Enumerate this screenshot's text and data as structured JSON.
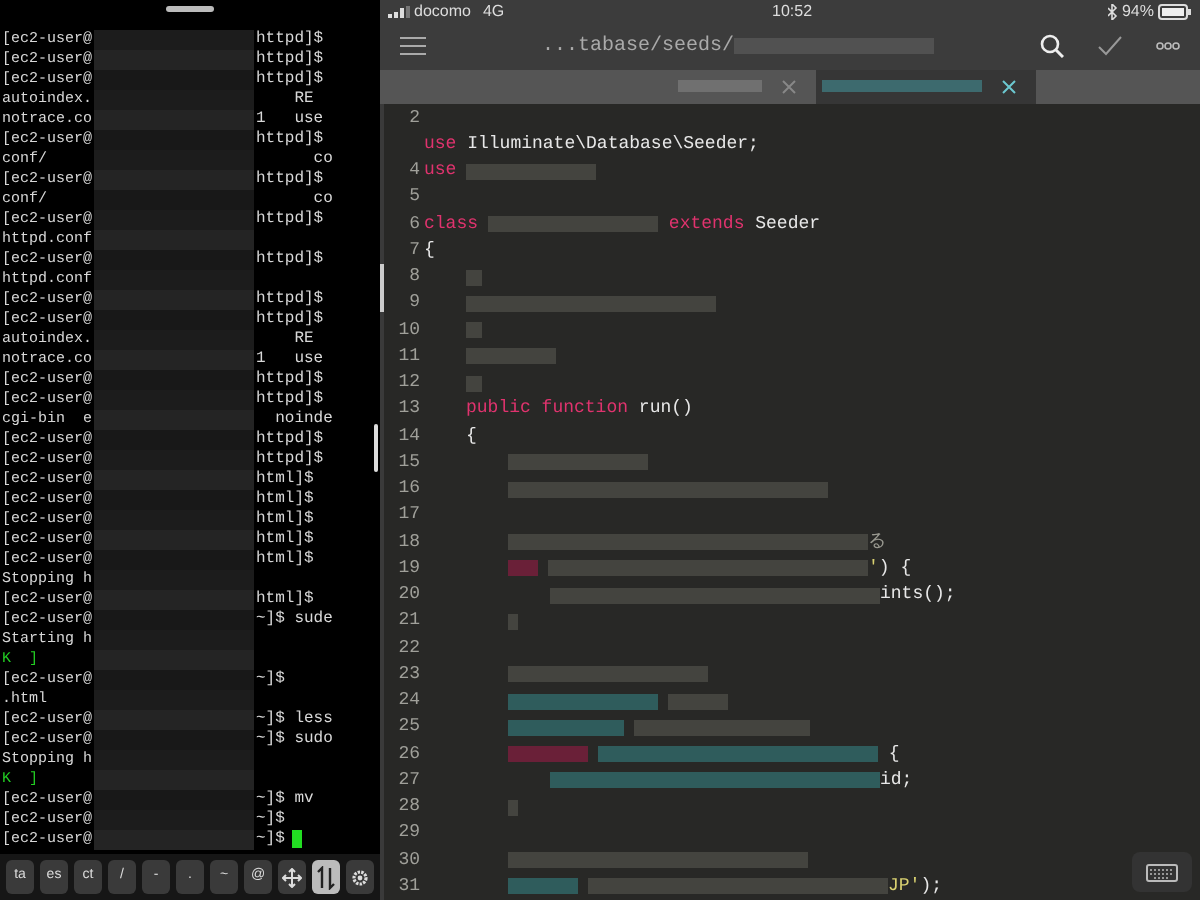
{
  "terminal": {
    "lines": [
      {
        "left": "[ec2-user@",
        "right": "httpd]$"
      },
      {
        "left": "[ec2-user@",
        "right": "httpd]$"
      },
      {
        "left": "[ec2-user@",
        "right": "httpd]$"
      },
      {
        "left": "autoindex.",
        "right": "    RE"
      },
      {
        "left": "notrace.co",
        "right": "1   use"
      },
      {
        "left": "[ec2-user@",
        "right": "httpd]$"
      },
      {
        "left": "conf/",
        "right": "      co"
      },
      {
        "left": "[ec2-user@",
        "right": "httpd]$"
      },
      {
        "left": "conf/",
        "right": "      co"
      },
      {
        "left": "[ec2-user@",
        "right": "httpd]$"
      },
      {
        "left": "httpd.conf"
      },
      {
        "left": "[ec2-user@",
        "right": "httpd]$"
      },
      {
        "left": "httpd.conf"
      },
      {
        "left": "[ec2-user@",
        "right": "httpd]$"
      },
      {
        "left": "[ec2-user@",
        "right": "httpd]$"
      },
      {
        "left": "autoindex.",
        "right": "    RE"
      },
      {
        "left": "notrace.co",
        "right": "1   use"
      },
      {
        "left": "[ec2-user@",
        "right": "httpd]$"
      },
      {
        "left": "[ec2-user@",
        "right": "httpd]$"
      },
      {
        "left": "cgi-bin  e",
        "right": "  noinde"
      },
      {
        "left": "[ec2-user@",
        "right": "httpd]$"
      },
      {
        "left": "[ec2-user@",
        "right": "httpd]$"
      },
      {
        "left": "[ec2-user@",
        "right": "html]$"
      },
      {
        "left": "[ec2-user@",
        "right": "html]$"
      },
      {
        "left": "[ec2-user@",
        "right": "html]$"
      },
      {
        "left": "[ec2-user@",
        "right": "html]$"
      },
      {
        "left": "[ec2-user@",
        "right": "html]$"
      },
      {
        "left": "Stopping h"
      },
      {
        "left": "[ec2-user@",
        "right": "html]$"
      },
      {
        "left": "[ec2-user@",
        "right": "~]$ sude"
      },
      {
        "left": "Starting h"
      },
      {
        "left": "K  ]",
        "kind": "ok"
      },
      {
        "left": "[ec2-user@",
        "right": "~]$"
      },
      {
        "left": ".html"
      },
      {
        "left": "[ec2-user@",
        "right": "~]$ less"
      },
      {
        "left": "[ec2-user@",
        "right": "~]$ sudo"
      },
      {
        "left": "Stopping h"
      },
      {
        "left": "K  ]",
        "kind": "ok"
      },
      {
        "left": "[ec2-user@",
        "right": "~]$ mv"
      },
      {
        "left": "[ec2-user@",
        "right": "~]$"
      },
      {
        "left": "[ec2-user@",
        "right": "~]$",
        "cursor": true
      }
    ],
    "keys": [
      {
        "kind": "text",
        "label": "ta",
        "on": false
      },
      {
        "kind": "text",
        "label": "es",
        "on": false
      },
      {
        "kind": "text",
        "label": "ct",
        "on": false
      },
      {
        "kind": "text",
        "label": "/",
        "on": false
      },
      {
        "kind": "text",
        "label": "-",
        "on": false
      },
      {
        "kind": "text",
        "label": ".",
        "on": false
      },
      {
        "kind": "text",
        "label": "~",
        "on": false
      },
      {
        "kind": "text",
        "label": "@",
        "on": false
      },
      {
        "kind": "move",
        "on": false
      },
      {
        "kind": "swap",
        "on": true
      },
      {
        "kind": "settings",
        "on": false
      }
    ]
  },
  "status_bar": {
    "carrier": "docomo",
    "network": "4G",
    "time": "10:52",
    "battery": "94%"
  },
  "editor": {
    "path": "...tabase/seeds/",
    "tabs": [
      {
        "selected": false
      },
      {
        "selected": true
      }
    ],
    "lines": [
      {
        "number": "2"
      },
      {
        "tokens": [
          {
            "kind": "keyword",
            "text": "use"
          },
          {
            "kind": "plain",
            "text": " Illuminate\\Database\\Seeder;"
          }
        ]
      },
      {
        "number": "4",
        "tokens": [
          {
            "kind": "keyword",
            "text": "use"
          },
          {
            "kind": "blurred",
            "color": "#44443f"
          }
        ]
      },
      {
        "number": "5"
      },
      {
        "number": "6",
        "tokens": [
          {
            "kind": "keyword",
            "text": "class"
          },
          {
            "kind": "blurred",
            "color": "#44443f"
          },
          {
            "kind": "keyword",
            "text": "extends"
          },
          {
            "kind": "plain",
            "text": " Seeder"
          }
        ]
      },
      {
        "number": "7",
        "tokens": [
          {
            "kind": "plain",
            "text": "{"
          }
        ],
        "children": [
          {
            "number": "8",
            "tokens": [
              {
                "kind": "blurred",
                "color": "#44443f"
              }
            ]
          },
          {
            "number": "9",
            "tokens": [
              {
                "kind": "blurred",
                "color": "#44443f"
              }
            ]
          },
          {
            "number": "10",
            "tokens": [
              {
                "kind": "blurred",
                "color": "#44443f"
              }
            ]
          },
          {
            "number": "11",
            "tokens": [
              {
                "kind": "blurred",
                "color": "#44443f"
              }
            ]
          },
          {
            "number": "12",
            "tokens": [
              {
                "kind": "blurred",
                "color": "#44443f"
              }
            ]
          },
          {
            "number": "13",
            "tokens": [
              {
                "kind": "keyword",
                "text": "public function"
              },
              {
                "kind": "plain",
                "text": " run()"
              }
            ]
          },
          {
            "number": "14",
            "tokens": [
              {
                "kind": "plain",
                "text": "{"
              }
            ],
            "children": [
              {
                "number": "15",
                "tokens": [
                  {
                    "kind": "blurred",
                    "color": "#44443f"
                  }
                ]
              },
              {
                "number": "16",
                "tokens": [
                  {
                    "kind": "blurred",
                    "color": "#44443f"
                  }
                ]
              },
              {
                "number": "17"
              },
              {
                "number": "18",
                "tokens": [
                  {
                    "kind": "blurred",
                    "color": "#44443f"
                  },
                  {
                    "kind": "comment",
                    "text": "る"
                  }
                ]
              },
              {
                "number": "19",
                "tokens": [
                  {
                    "kind": "blurred",
                    "color": "#6a2038"
                  },
                  {
                    "kind": "blurred",
                    "color": "#44443f"
                  },
                  {
                    "kind": "string",
                    "text": "'"
                  },
                  {
                    "kind": "plain",
                    "text": ") {"
                  }
                ],
                "children": [
                  {
                    "number": "20",
                    "tokens": [
                      {
                        "kind": "blurred",
                        "color": "#44443f"
                      },
                      {
                        "kind": "plain",
                        "text": "ints();"
                      }
                    ]
                  }
                ]
              },
              {
                "number": "21",
                "tokens": [
                  {
                    "kind": "blurred",
                    "color": "#44443f"
                  }
                ]
              },
              {
                "number": "22"
              },
              {
                "number": "23",
                "tokens": [
                  {
                    "kind": "blurred",
                    "color": "#44443f"
                  }
                ]
              },
              {
                "number": "24",
                "tokens": [
                  {
                    "kind": "blurred",
                    "color": "#2f5c5c"
                  },
                  {
                    "kind": "blurred",
                    "color": "#44443f"
                  }
                ]
              },
              {
                "number": "25",
                "tokens": [
                  {
                    "kind": "blurred",
                    "color": "#2f5c5c"
                  },
                  {
                    "kind": "blurred",
                    "color": "#44443f"
                  }
                ]
              },
              {
                "number": "26",
                "tokens": [
                  {
                    "kind": "blurred",
                    "color": "#6a2038"
                  },
                  {
                    "kind": "blurred",
                    "color": "#2f5c5c"
                  },
                  {
                    "kind": "plain",
                    "text": " {"
                  }
                ],
                "children": [
                  {
                    "number": "27",
                    "tokens": [
                      {
                        "kind": "blurred",
                        "color": "#2f5c5c"
                      },
                      {
                        "kind": "plain",
                        "text": "id;"
                      }
                    ]
                  }
                ]
              },
              {
                "number": "28",
                "tokens": [
                  {
                    "kind": "blurred",
                    "color": "#44443f"
                  }
                ]
              },
              {
                "number": "29"
              },
              {
                "number": "30",
                "tokens": [
                  {
                    "kind": "blurred",
                    "color": "#44443f"
                  }
                ]
              },
              {
                "number": "31",
                "tokens": [
                  {
                    "kind": "blurred",
                    "color": "#2f5c5c"
                  },
                  {
                    "kind": "blurred",
                    "color": "#44443f"
                  },
                  {
                    "kind": "string",
                    "text": "JP'"
                  },
                  {
                    "kind": "plain",
                    "text": ");"
                  }
                ]
              }
            ]
          }
        ]
      }
    ]
  }
}
